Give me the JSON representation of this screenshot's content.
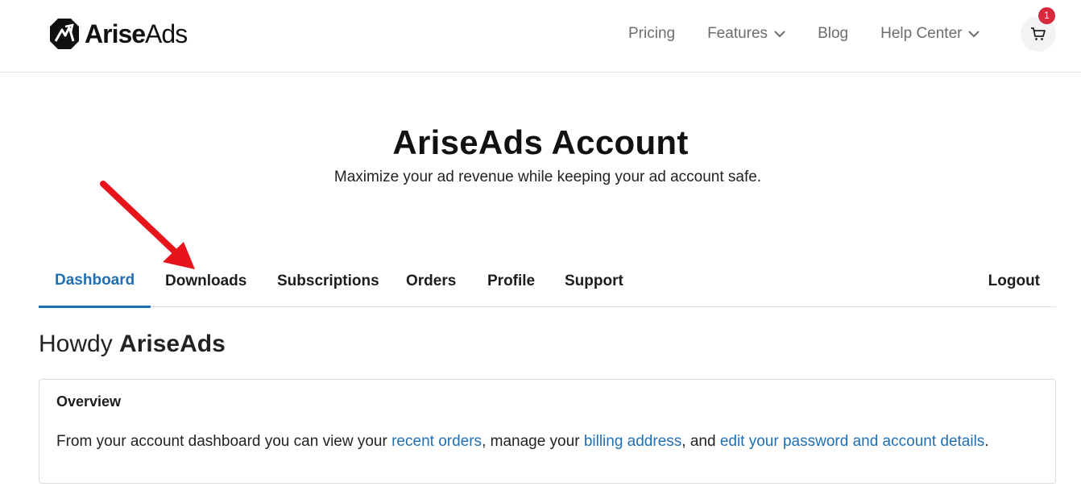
{
  "brand": {
    "name_bold": "Arise",
    "name_light": "Ads"
  },
  "nav": {
    "items": [
      {
        "label": "Pricing",
        "has_dropdown": false
      },
      {
        "label": "Features",
        "has_dropdown": true
      },
      {
        "label": "Blog",
        "has_dropdown": false
      },
      {
        "label": "Help Center",
        "has_dropdown": true
      }
    ],
    "cart_count": "1"
  },
  "hero": {
    "title": "AriseAds Account",
    "subtitle": "Maximize your ad revenue while keeping your ad account safe."
  },
  "tabs": {
    "items": [
      {
        "label": "Dashboard",
        "active": true
      },
      {
        "label": "Downloads",
        "active": false
      },
      {
        "label": "Subscriptions",
        "active": false
      },
      {
        "label": "Orders",
        "active": false
      },
      {
        "label": "Profile",
        "active": false
      },
      {
        "label": "Support",
        "active": false
      }
    ],
    "logout": "Logout"
  },
  "greeting": {
    "prefix": "Howdy",
    "username": "AriseAds"
  },
  "overview": {
    "title": "Overview",
    "text_1": "From your account dashboard you can view your ",
    "link_1": "recent orders",
    "text_2": ", manage your ",
    "link_2": "billing address",
    "text_3": ", and ",
    "link_3": "edit your password and account details",
    "text_4": "."
  },
  "colors": {
    "accent": "#1f6fb5",
    "badge": "#d6293b",
    "annotation_arrow": "#e8141c"
  }
}
